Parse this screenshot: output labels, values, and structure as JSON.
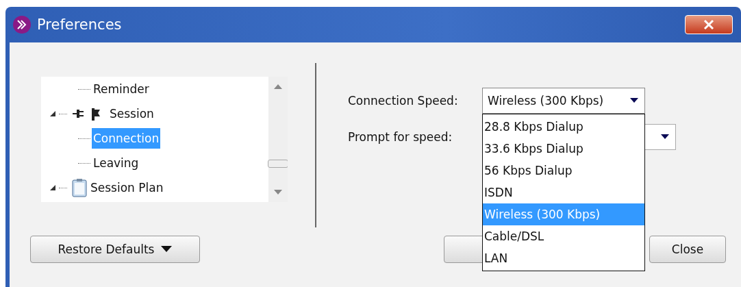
{
  "window": {
    "title": "Preferences"
  },
  "tree": {
    "items": [
      {
        "children": [
          {
            "label": "Reminder",
            "selected": false
          }
        ]
      },
      {
        "label": "Session",
        "expanded": true,
        "selected": false,
        "children": [
          {
            "label": "Connection",
            "selected": true
          },
          {
            "label": "Leaving",
            "selected": false
          }
        ]
      },
      {
        "label": "Session Plan",
        "expanded": true,
        "selected": false
      }
    ]
  },
  "settings": [
    {
      "label": "Connection Speed:",
      "value": "Wireless (300 Kbps)",
      "open": true,
      "options": [
        {
          "label": "28.8 Kbps Dialup",
          "selected": false
        },
        {
          "label": "33.6 Kbps Dialup",
          "selected": false
        },
        {
          "label": "56 Kbps Dialup",
          "selected": false
        },
        {
          "label": "ISDN",
          "selected": false
        },
        {
          "label": "Wireless (300 Kbps)",
          "selected": true
        },
        {
          "label": "Cable/DSL",
          "selected": false
        },
        {
          "label": "LAN",
          "selected": false
        }
      ]
    },
    {
      "label": "Prompt for speed:",
      "open": false
    }
  ],
  "buttons": {
    "restore": "Restore Defaults",
    "close": "Close"
  }
}
